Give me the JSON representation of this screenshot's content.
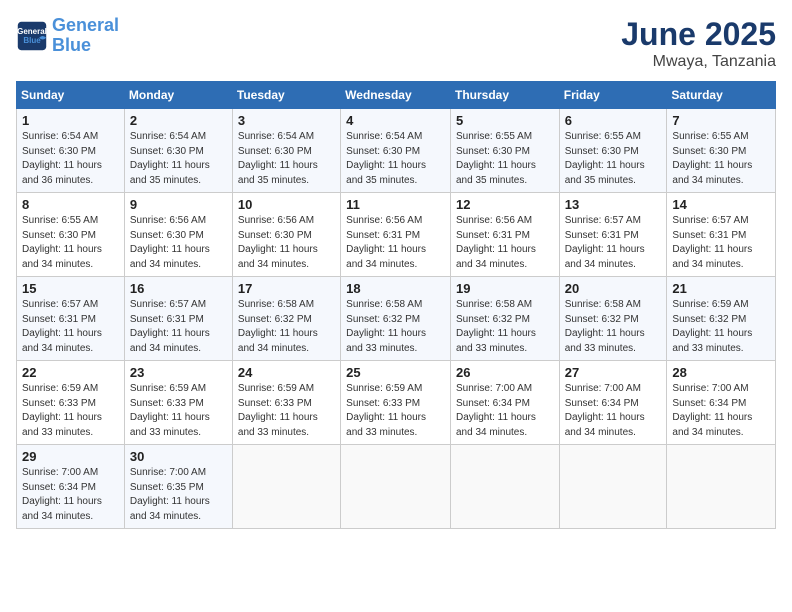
{
  "header": {
    "logo_line1": "General",
    "logo_line2": "Blue",
    "title": "June 2025",
    "subtitle": "Mwaya, Tanzania"
  },
  "calendar": {
    "days_of_week": [
      "Sunday",
      "Monday",
      "Tuesday",
      "Wednesday",
      "Thursday",
      "Friday",
      "Saturday"
    ],
    "weeks": [
      [
        null,
        null,
        null,
        null,
        null,
        null,
        null
      ]
    ],
    "cells": [
      {
        "day": "1",
        "sunrise": "6:54 AM",
        "sunset": "6:30 PM",
        "daylight": "11 hours and 36 minutes."
      },
      {
        "day": "2",
        "sunrise": "6:54 AM",
        "sunset": "6:30 PM",
        "daylight": "11 hours and 35 minutes."
      },
      {
        "day": "3",
        "sunrise": "6:54 AM",
        "sunset": "6:30 PM",
        "daylight": "11 hours and 35 minutes."
      },
      {
        "day": "4",
        "sunrise": "6:54 AM",
        "sunset": "6:30 PM",
        "daylight": "11 hours and 35 minutes."
      },
      {
        "day": "5",
        "sunrise": "6:55 AM",
        "sunset": "6:30 PM",
        "daylight": "11 hours and 35 minutes."
      },
      {
        "day": "6",
        "sunrise": "6:55 AM",
        "sunset": "6:30 PM",
        "daylight": "11 hours and 35 minutes."
      },
      {
        "day": "7",
        "sunrise": "6:55 AM",
        "sunset": "6:30 PM",
        "daylight": "11 hours and 34 minutes."
      },
      {
        "day": "8",
        "sunrise": "6:55 AM",
        "sunset": "6:30 PM",
        "daylight": "11 hours and 34 minutes."
      },
      {
        "day": "9",
        "sunrise": "6:56 AM",
        "sunset": "6:30 PM",
        "daylight": "11 hours and 34 minutes."
      },
      {
        "day": "10",
        "sunrise": "6:56 AM",
        "sunset": "6:30 PM",
        "daylight": "11 hours and 34 minutes."
      },
      {
        "day": "11",
        "sunrise": "6:56 AM",
        "sunset": "6:31 PM",
        "daylight": "11 hours and 34 minutes."
      },
      {
        "day": "12",
        "sunrise": "6:56 AM",
        "sunset": "6:31 PM",
        "daylight": "11 hours and 34 minutes."
      },
      {
        "day": "13",
        "sunrise": "6:57 AM",
        "sunset": "6:31 PM",
        "daylight": "11 hours and 34 minutes."
      },
      {
        "day": "14",
        "sunrise": "6:57 AM",
        "sunset": "6:31 PM",
        "daylight": "11 hours and 34 minutes."
      },
      {
        "day": "15",
        "sunrise": "6:57 AM",
        "sunset": "6:31 PM",
        "daylight": "11 hours and 34 minutes."
      },
      {
        "day": "16",
        "sunrise": "6:57 AM",
        "sunset": "6:31 PM",
        "daylight": "11 hours and 34 minutes."
      },
      {
        "day": "17",
        "sunrise": "6:58 AM",
        "sunset": "6:32 PM",
        "daylight": "11 hours and 34 minutes."
      },
      {
        "day": "18",
        "sunrise": "6:58 AM",
        "sunset": "6:32 PM",
        "daylight": "11 hours and 33 minutes."
      },
      {
        "day": "19",
        "sunrise": "6:58 AM",
        "sunset": "6:32 PM",
        "daylight": "11 hours and 33 minutes."
      },
      {
        "day": "20",
        "sunrise": "6:58 AM",
        "sunset": "6:32 PM",
        "daylight": "11 hours and 33 minutes."
      },
      {
        "day": "21",
        "sunrise": "6:59 AM",
        "sunset": "6:32 PM",
        "daylight": "11 hours and 33 minutes."
      },
      {
        "day": "22",
        "sunrise": "6:59 AM",
        "sunset": "6:33 PM",
        "daylight": "11 hours and 33 minutes."
      },
      {
        "day": "23",
        "sunrise": "6:59 AM",
        "sunset": "6:33 PM",
        "daylight": "11 hours and 33 minutes."
      },
      {
        "day": "24",
        "sunrise": "6:59 AM",
        "sunset": "6:33 PM",
        "daylight": "11 hours and 33 minutes."
      },
      {
        "day": "25",
        "sunrise": "6:59 AM",
        "sunset": "6:33 PM",
        "daylight": "11 hours and 33 minutes."
      },
      {
        "day": "26",
        "sunrise": "7:00 AM",
        "sunset": "6:34 PM",
        "daylight": "11 hours and 34 minutes."
      },
      {
        "day": "27",
        "sunrise": "7:00 AM",
        "sunset": "6:34 PM",
        "daylight": "11 hours and 34 minutes."
      },
      {
        "day": "28",
        "sunrise": "7:00 AM",
        "sunset": "6:34 PM",
        "daylight": "11 hours and 34 minutes."
      },
      {
        "day": "29",
        "sunrise": "7:00 AM",
        "sunset": "6:34 PM",
        "daylight": "11 hours and 34 minutes."
      },
      {
        "day": "30",
        "sunrise": "7:00 AM",
        "sunset": "6:35 PM",
        "daylight": "11 hours and 34 minutes."
      }
    ]
  }
}
